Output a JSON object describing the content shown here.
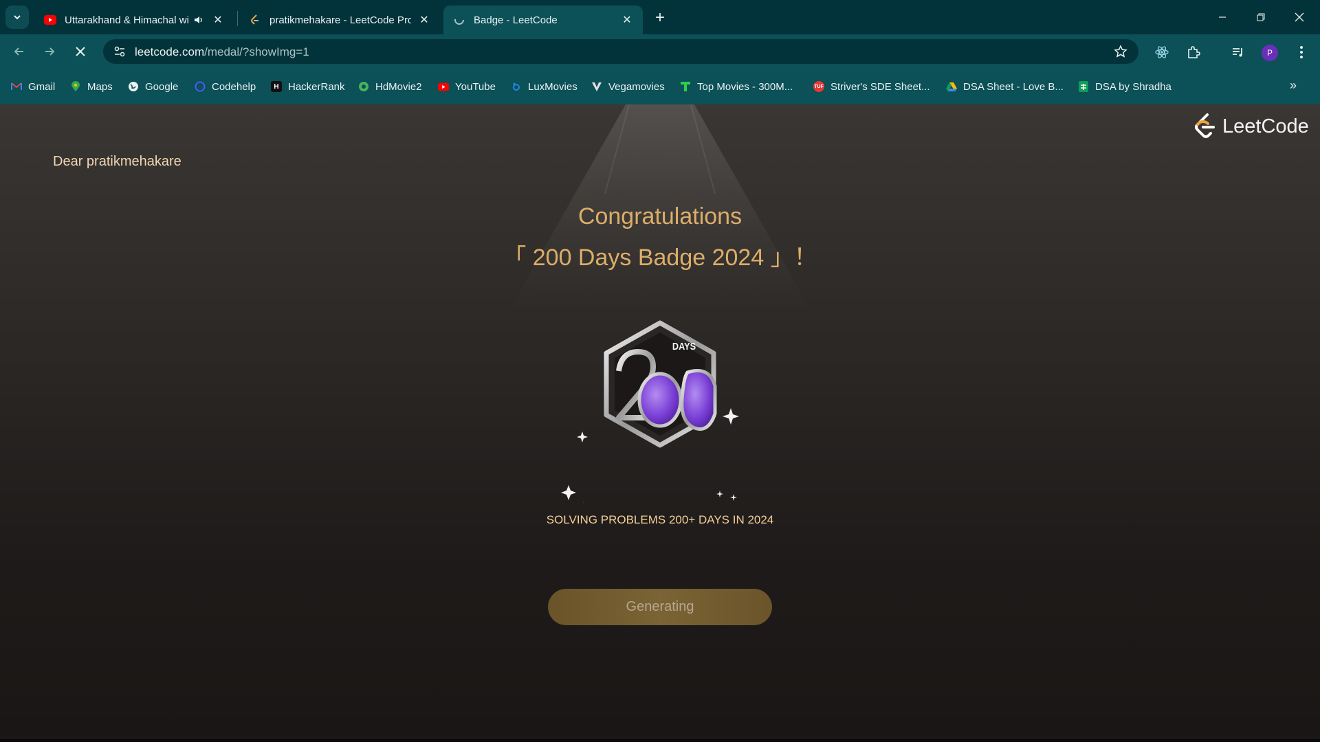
{
  "browser": {
    "tabs": [
      {
        "title": "Uttarakhand & Himachal wi",
        "favicon": "youtube-icon",
        "audio": true,
        "active": false
      },
      {
        "title": "pratikmehakare - LeetCode Pro",
        "favicon": "leetcode-icon",
        "audio": false,
        "active": false
      },
      {
        "title": "Badge - LeetCode",
        "favicon": "loading-icon",
        "audio": false,
        "active": true
      }
    ],
    "address": {
      "host": "leetcode.com",
      "path": "/medal/?showImg=1"
    },
    "profile_initial": "P",
    "bookmarks": [
      {
        "label": "Gmail",
        "icon": "gmail-icon",
        "color": "#ea4335"
      },
      {
        "label": "Maps",
        "icon": "maps-icon",
        "color": "#34a853"
      },
      {
        "label": "Google",
        "icon": "globe-icon",
        "color": "#ffffff"
      },
      {
        "label": "Codehelp",
        "icon": "codehelp-icon",
        "color": "#4a5cff"
      },
      {
        "label": "HackerRank",
        "icon": "hackerrank-icon",
        "color": "#111111"
      },
      {
        "label": "HdMovie2",
        "icon": "hdmovie-icon",
        "color": "#49b35a"
      },
      {
        "label": "YouTube",
        "icon": "youtube-icon",
        "color": "#ff0000"
      },
      {
        "label": "LuxMovies",
        "icon": "luxmovies-icon",
        "color": "#1e88e5"
      },
      {
        "label": "Vegamovies",
        "icon": "vegamovies-icon",
        "color": "#e0e0e0"
      },
      {
        "label": "Top Movies - 300M...",
        "icon": "topmovies-icon",
        "color": "#2bd14a"
      },
      {
        "label": "Striver's SDE Sheet...",
        "icon": "striver-icon",
        "color": "#e53935"
      },
      {
        "label": "DSA Sheet - Love B...",
        "icon": "google-drive-icon",
        "color": "#fbbc05"
      },
      {
        "label": "DSA by Shradha",
        "icon": "google-sheets-icon",
        "color": "#0f9d58"
      }
    ]
  },
  "page": {
    "greeting": "Dear pratikmehakare",
    "logo_text": "LeetCode",
    "congrats": "Congratulations",
    "badge_title": "「 200 Days Badge 2024 」！",
    "badge_days_label": "DAYS",
    "badge_description": "SOLVING PROBLEMS 200+ DAYS IN 2024",
    "button_label": "Generating",
    "accent_color": "#dcae69"
  }
}
